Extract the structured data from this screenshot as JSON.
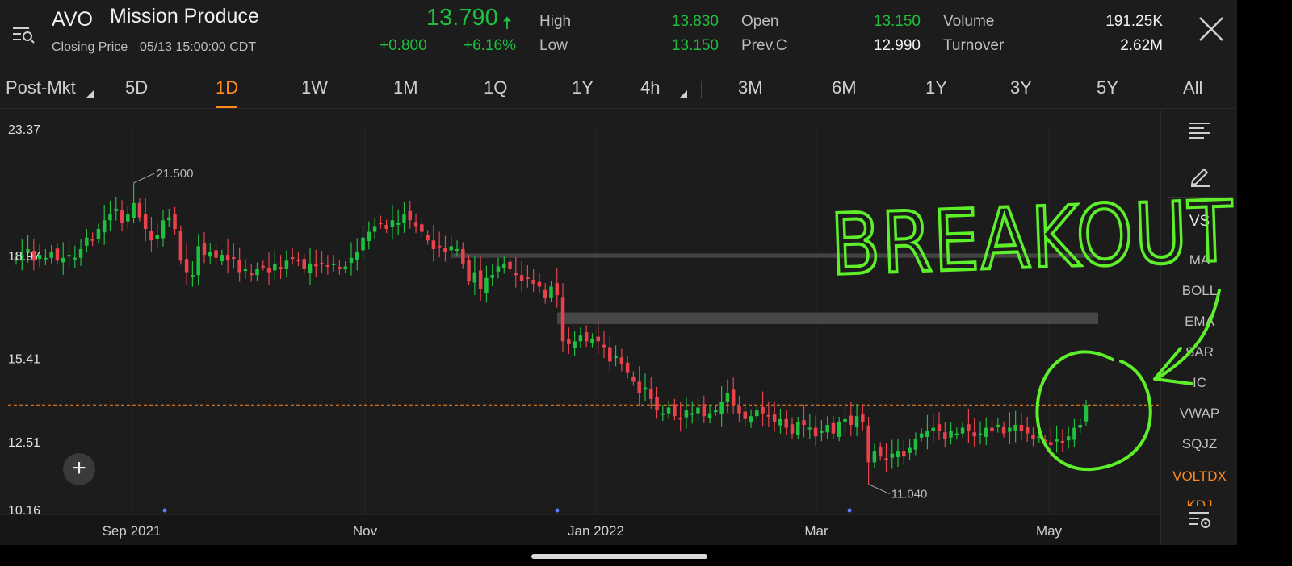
{
  "header": {
    "ticker": "AVO",
    "company": "Mission Produce",
    "closing_label": "Closing Price",
    "closing_time": "05/13 15:00:00 CDT",
    "price": "13.790",
    "price_arrow": "🠅",
    "change": "+0.800",
    "change_pct": "+6.16%",
    "stats": {
      "high_label": "High",
      "high": "13.830",
      "low_label": "Low",
      "low": "13.150",
      "open_label": "Open",
      "open": "13.150",
      "prevc_label": "Prev.C",
      "prevc": "12.990",
      "volume_label": "Volume",
      "volume": "191.25K",
      "turnover_label": "Turnover",
      "turnover": "2.62M"
    }
  },
  "tabs": [
    {
      "label": "Post-Mkt"
    },
    {
      "label": "5D"
    },
    {
      "label": "1D"
    },
    {
      "label": "1W"
    },
    {
      "label": "1M"
    },
    {
      "label": "1Q"
    },
    {
      "label": "1Y"
    },
    {
      "label": "4h"
    },
    {
      "label": "3M"
    },
    {
      "label": "6M"
    },
    {
      "label": "1Y"
    },
    {
      "label": "3Y"
    },
    {
      "label": "5Y"
    },
    {
      "label": "All"
    }
  ],
  "active_tab": "1D",
  "sidebar": {
    "items": [
      "VS",
      "MA",
      "BOLL",
      "EMA",
      "SAR",
      "IC",
      "VWAP",
      "SQJZ",
      "VOLTDX",
      "KDJ"
    ]
  },
  "annotation": {
    "text": "BREAKOUT"
  },
  "colors": {
    "up": "#1fbf3f",
    "down": "#e8424c",
    "accent": "#ff8a1c",
    "annotation": "#5df02a",
    "background": "#1c1c1c"
  },
  "chart_data": {
    "type": "candlestick",
    "yticks": [
      "23.37",
      "18.97",
      "15.41",
      "12.51",
      "10.16"
    ],
    "ylim": [
      10.16,
      23.37
    ],
    "xticks": [
      "Sep 2021",
      "Nov",
      "Jan 2022",
      "Mar",
      "May"
    ],
    "annotations": {
      "high_label": "21.500",
      "low_label": "11.040",
      "current_price": 13.79
    },
    "resistance_zones": [
      {
        "from": 18.9,
        "to": 19.05
      },
      {
        "from": 16.6,
        "to": 17.0
      }
    ],
    "closes": [
      18.9,
      19.0,
      19.2,
      18.8,
      19.0,
      18.9,
      19.1,
      18.8,
      18.9,
      19.0,
      18.9,
      19.2,
      19.6,
      19.5,
      19.9,
      20.2,
      20.4,
      20.6,
      20.1,
      20.4,
      20.8,
      20.3,
      19.9,
      19.5,
      19.7,
      20.2,
      20.3,
      19.9,
      18.8,
      18.4,
      18.3,
      19.3,
      19.0,
      19.1,
      18.9,
      19.0,
      18.8,
      18.9,
      18.4,
      18.5,
      18.3,
      18.5,
      18.6,
      18.4,
      18.7,
      18.5,
      18.8,
      18.9,
      18.8,
      18.5,
      18.7,
      18.6,
      18.7,
      18.6,
      18.7,
      18.5,
      18.6,
      18.9,
      19.1,
      19.6,
      19.8,
      20.0,
      20.1,
      19.9,
      20.2,
      20.1,
      20.4,
      20.2,
      20.0,
      19.8,
      19.5,
      19.2,
      19.3,
      19.1,
      19.3,
      19.2,
      18.7,
      18.1,
      18.4,
      17.8,
      18.2,
      18.3,
      18.6,
      18.7,
      18.5,
      18.3,
      18.1,
      18.2,
      18.0,
      17.9,
      17.5,
      17.9,
      17.6,
      16.0,
      15.9,
      16.0,
      16.2,
      16.0,
      16.1,
      16.0,
      15.8,
      15.3,
      15.5,
      15.2,
      14.9,
      14.6,
      14.2,
      14.4,
      14.0,
      13.6,
      13.5,
      13.7,
      13.4,
      13.3,
      13.6,
      13.5,
      13.7,
      13.4,
      13.5,
      13.6,
      13.9,
      14.2,
      13.8,
      13.5,
      13.3,
      13.4,
      13.6,
      13.5,
      13.4,
      13.2,
      13.3,
      13.0,
      12.8,
      13.2,
      13.1,
      13.0,
      12.7,
      12.9,
      13.1,
      12.8,
      13.2,
      13.3,
      13.1,
      13.4,
      13.2,
      11.8,
      12.2,
      12.0,
      11.9,
      12.1,
      12.2,
      12.0,
      12.3,
      12.6,
      12.8,
      12.9,
      13.0,
      12.9,
      12.6,
      12.9,
      12.8,
      13.0,
      12.9,
      12.7,
      12.8,
      13.0,
      12.9,
      13.1,
      12.8,
      13.0,
      13.1,
      12.9,
      12.8,
      12.6,
      12.7,
      12.5,
      12.4,
      12.6,
      12.5,
      12.7,
      13.0,
      13.1,
      13.79
    ]
  }
}
